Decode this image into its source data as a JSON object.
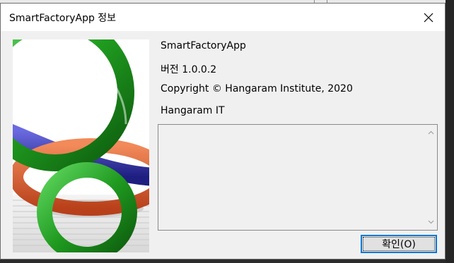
{
  "window": {
    "title": "SmartFactoryApp 정보",
    "close_icon": "close-icon"
  },
  "about": {
    "product_name": "SmartFactoryApp",
    "version": "버전 1.0.0.2",
    "copyright": "Copyright ©  Hangaram Institute, 2020",
    "company": "Hangaram IT"
  },
  "description": {
    "value": ""
  },
  "buttons": {
    "ok_label": "확인(O)"
  },
  "colors": {
    "dialog_bg": "#f0f0f0",
    "titlebar_bg": "#ffffff",
    "button_focus_border": "#0078d7",
    "logo_green": "#2ea12e",
    "logo_orange": "#e0602c",
    "logo_blue": "#3a3aa8"
  }
}
